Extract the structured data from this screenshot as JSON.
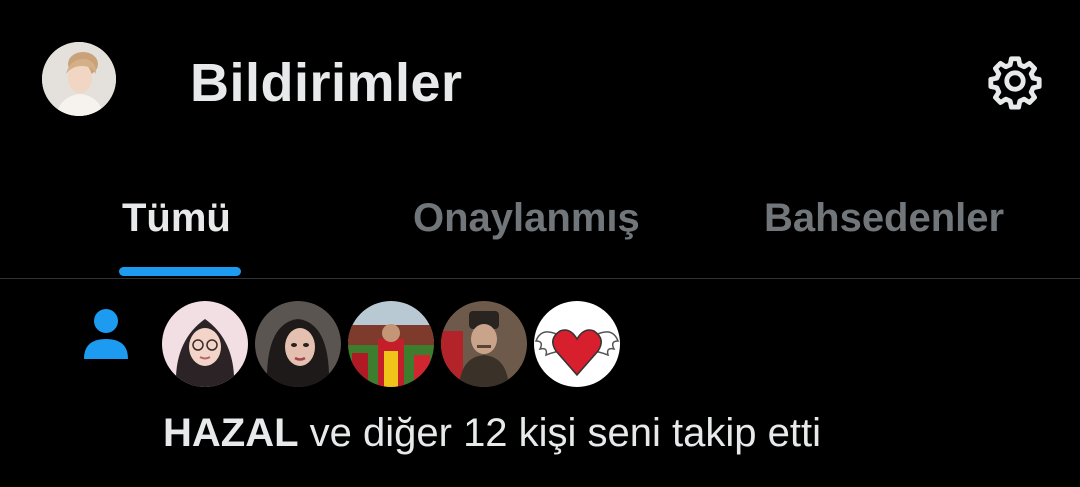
{
  "header": {
    "title": "Bildirimler",
    "avatar_icon": "user-profile-avatar",
    "settings_icon": "gear-icon"
  },
  "tabs": [
    {
      "label": "Tümü",
      "active": true
    },
    {
      "label": "Onaylanmış",
      "active": false
    },
    {
      "label": "Bahsedenler",
      "active": false
    }
  ],
  "notification": {
    "type_icon": "person-icon",
    "name": "HAZAL",
    "text": " ve diğer 12 kişi seni takip etti",
    "avatars": [
      "avatar-woman-hijab",
      "avatar-woman-dark-hair",
      "avatar-football-stadium",
      "avatar-historical-portrait",
      "avatar-winged-heart"
    ]
  },
  "colors": {
    "background": "#000000",
    "text_primary": "#e7e9ea",
    "text_secondary": "#71767b",
    "accent": "#1d9bf0",
    "divider": "#2f3336"
  }
}
